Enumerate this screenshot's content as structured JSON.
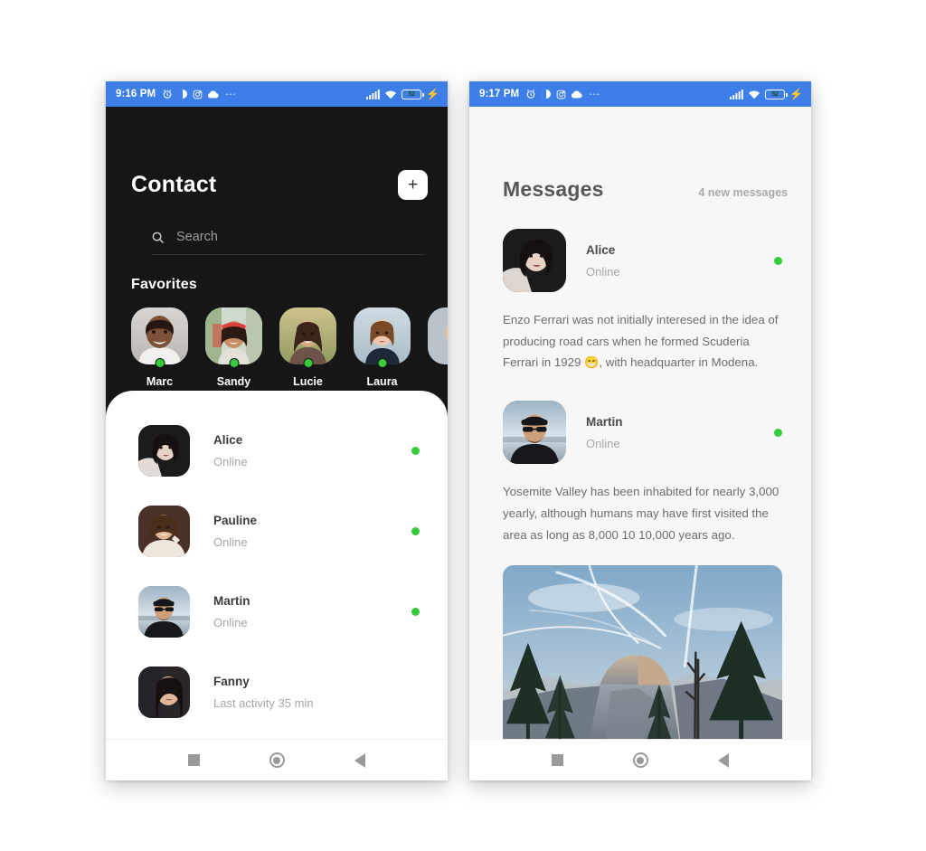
{
  "phones": {
    "left": {
      "statusbar": {
        "time": "9:16 PM",
        "icons": [
          "alarm-icon",
          "brightness-icon",
          "instagram-icon",
          "cloud-icon",
          "overflow-dots-icon"
        ],
        "dots": "⋯",
        "signal": "signal-bars-icon",
        "wifi": "wifi-icon",
        "battery_level": "52",
        "battery_charging": "⚡"
      },
      "header": {
        "title": "Contact",
        "add_label": "+"
      },
      "search": {
        "placeholder": "Search",
        "value": "",
        "icon": "search-icon"
      },
      "favorites": {
        "section_title": "Favorites",
        "items": [
          {
            "name": "Marc",
            "online": true
          },
          {
            "name": "Sandy",
            "online": true
          },
          {
            "name": "Lucie",
            "online": true
          },
          {
            "name": "Laura",
            "online": true
          }
        ]
      },
      "contacts": [
        {
          "name": "Alice",
          "status": "Online",
          "online": true
        },
        {
          "name": "Pauline",
          "status": "Online",
          "online": true
        },
        {
          "name": "Martin",
          "status": "Online",
          "online": true
        },
        {
          "name": "Fanny",
          "status": "Last activity 35 min",
          "online": false
        }
      ]
    },
    "right": {
      "statusbar": {
        "time": "9:17 PM",
        "dots": "⋯",
        "battery_level": "52",
        "battery_charging": "⚡"
      },
      "header": {
        "title": "Messages",
        "count_label": "4 new messages"
      },
      "messages": [
        {
          "name": "Alice",
          "status": "Online",
          "online": true,
          "text_before": "Enzo Ferrari was not initially interesed in the idea of producing road cars when he formed Scuderia Ferrari in 1929 ",
          "emoji": "😁",
          "text_after": ", with headquarter in Modena.",
          "has_image": false
        },
        {
          "name": "Martin",
          "status": "Online",
          "online": true,
          "text_before": "Yosemite Valley has been inhabited for nearly 3,000 yearly, although humans may have first visited the area as long as 8,000 10 10,000 years ago.",
          "emoji": "",
          "text_after": "",
          "has_image": true,
          "image_alt": "yosemite-half-dome-photo"
        }
      ]
    }
  },
  "navbar": {
    "recents": "square-recents-icon",
    "home": "circle-home-icon",
    "back": "triangle-back-icon"
  },
  "colors": {
    "status_bar": "#3d7ee8",
    "dark_panel": "#161616",
    "online_green": "#35cc3a",
    "page_bg": "#f7f7f7",
    "text_muted": "#a6a6a6"
  }
}
